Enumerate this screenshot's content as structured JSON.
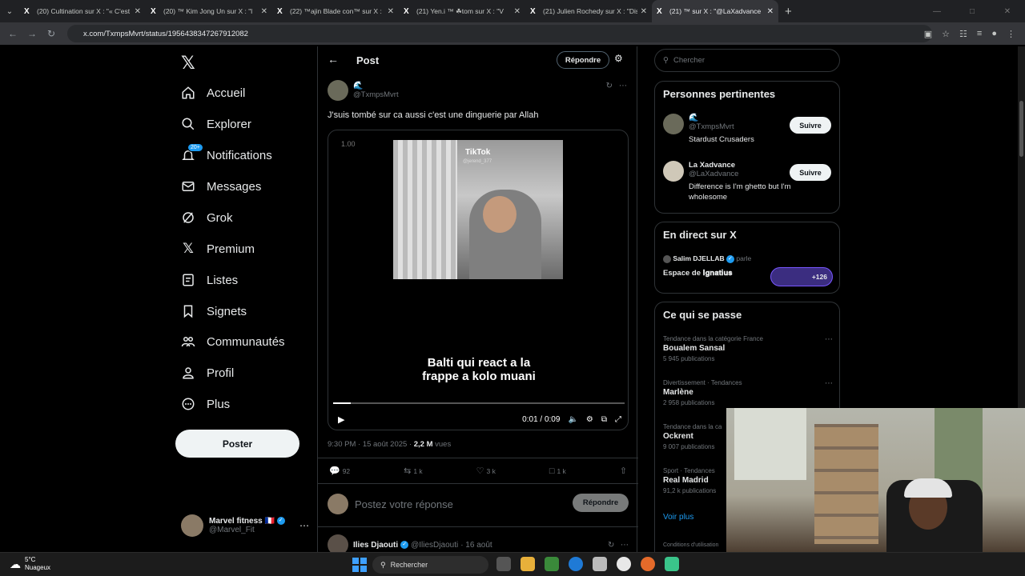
{
  "browser": {
    "tabs": [
      {
        "title": "(20) Cultination sur X : \"« C'est l",
        "active": false
      },
      {
        "title": "(20) ™ Kim Jong Un sur X : \"l",
        "active": false
      },
      {
        "title": "(22) ™ajin Blade con™ sur X :",
        "active": false
      },
      {
        "title": "(21) Yen.i ™ ☘tom sur X : \"V",
        "active": false
      },
      {
        "title": "(21) Julien Rochedy sur X : \"Dis",
        "active": false
      },
      {
        "title": "(21) ™ sur X : \"@LaXadvance",
        "active": true
      }
    ],
    "url": "x.com/TxmpsMvrt/status/1956438347267912082"
  },
  "nav": {
    "items": [
      {
        "label": "Accueil",
        "icon": "home-icon"
      },
      {
        "label": "Explorer",
        "icon": "search-icon"
      },
      {
        "label": "Notifications",
        "icon": "bell-icon",
        "badge": "20+"
      },
      {
        "label": "Messages",
        "icon": "envelope-icon"
      },
      {
        "label": "Grok",
        "icon": "grok-icon"
      },
      {
        "label": "Premium",
        "icon": "x-logo-icon"
      },
      {
        "label": "Listes",
        "icon": "list-icon"
      },
      {
        "label": "Signets",
        "icon": "bookmark-icon"
      },
      {
        "label": "Communautés",
        "icon": "communities-icon"
      },
      {
        "label": "Profil",
        "icon": "profile-icon"
      },
      {
        "label": "Plus",
        "icon": "more-circle-icon"
      }
    ],
    "post_button": "Poster",
    "account": {
      "name": "Marvel fitness 🇫🇷",
      "handle": "@Marvel_Fit"
    }
  },
  "post": {
    "header_title": "Post",
    "reply_button": "Répondre",
    "author_handle": "@TxmpsMvrt",
    "text": "J'suis tombé sur ca aussi c'est une dinguerie par Allah",
    "video": {
      "speed": "1.00",
      "watermark": "TikTok",
      "watermark_user": "@jerend_377",
      "subtitle_line1": "Balti qui react a la",
      "subtitle_line2": "frappe a kolo muani",
      "time": "0:01 / 0:09",
      "progress": 0.06
    },
    "meta_time": "9:30 PM · 15 août 2025 ·",
    "views_count": "2,2 M",
    "views_label": "vues",
    "stats": {
      "replies": "92",
      "reposts": "1 k",
      "likes": "3 k",
      "bookmarks": "1 k"
    },
    "reply_placeholder": "Postez votre réponse",
    "reply_submit": "Répondre",
    "first_reply": {
      "name": "Ilies Djaouti",
      "handle": "@IliesDjaouti",
      "date": "· 16 août"
    }
  },
  "sidebar": {
    "search_placeholder": "Chercher",
    "relevant": {
      "title": "Personnes pertinentes",
      "people": [
        {
          "name": "",
          "handle": "@TxmpsMvrt",
          "bio": "Stardust Crusaders",
          "button": "Suivre"
        },
        {
          "name": "La Xadvance",
          "handle": "@LaXadvance",
          "bio": "Difference is I'm ghetto but I'm wholesome",
          "button": "Suivre"
        }
      ]
    },
    "live": {
      "title": "En direct sur X",
      "host": "Salim DJELLAB",
      "host_suffix": "parle",
      "space": "Espace de 𝐈𝐠𝐧𝐚𝐭𝐢𝐮𝐬",
      "count": "+126"
    },
    "trends": {
      "title": "Ce qui se passe",
      "items": [
        {
          "category": "Tendance dans la catégorie France",
          "name": "Boualem Sansal",
          "count": "5 945 publications"
        },
        {
          "category": "Divertissement · Tendances",
          "name": "Marlène",
          "count": "2 958 publications"
        },
        {
          "category": "Tendance dans la ca",
          "name": "Ockrent",
          "count": "9 007 publications"
        },
        {
          "category": "Sport · Tendances",
          "name": "Real Madrid",
          "count": "91,2 k publications"
        }
      ],
      "more": "Voir plus",
      "footer": "Conditions d'utilisation"
    }
  },
  "taskbar": {
    "temp": "5°C",
    "weather": "Nuageux",
    "search": "Rechercher"
  },
  "colors": {
    "accent": "#1d9bf0",
    "background": "#000000",
    "border": "#2f3336"
  }
}
